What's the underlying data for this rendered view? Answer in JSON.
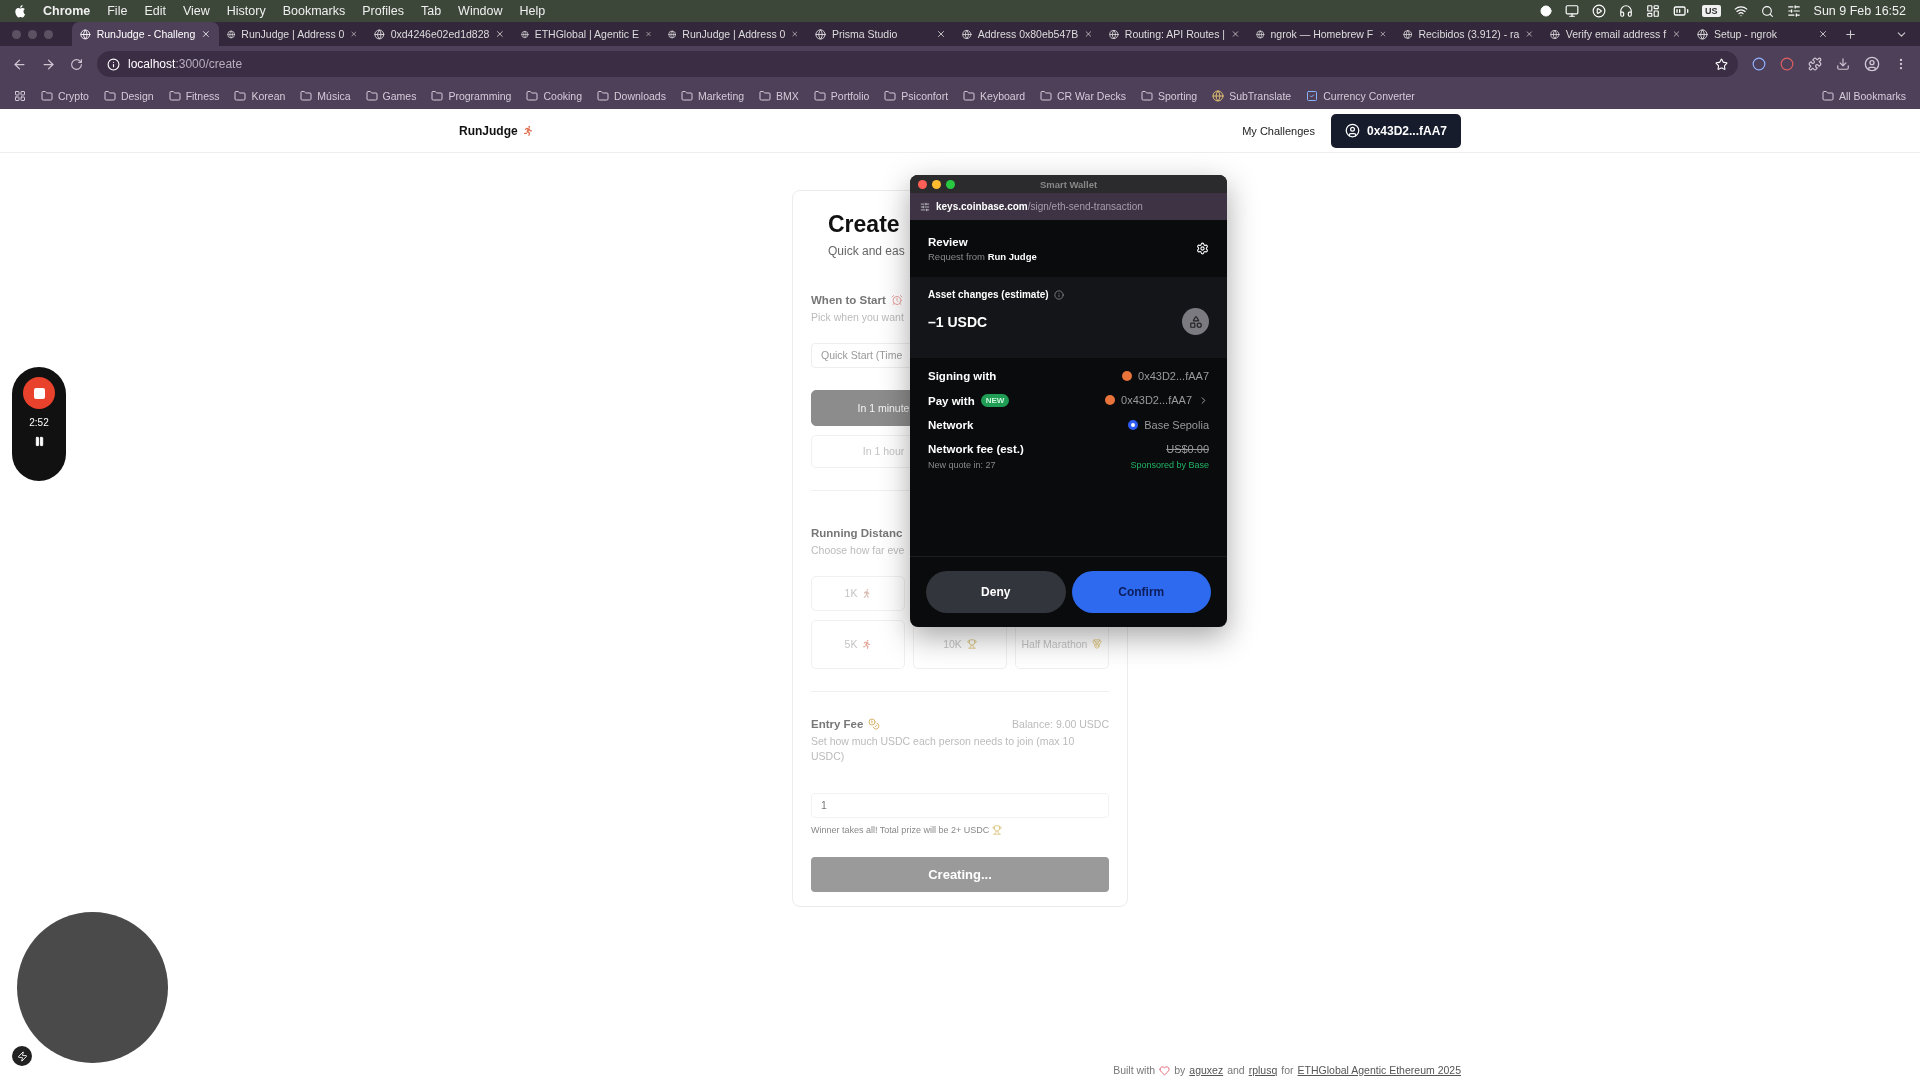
{
  "menu_bar": {
    "app": "Chrome",
    "items": [
      "File",
      "Edit",
      "View",
      "History",
      "Bookmarks",
      "Profiles",
      "Tab",
      "Window",
      "Help"
    ],
    "keyboard": "US",
    "clock": "Sun 9 Feb 16:52"
  },
  "tabs": [
    {
      "title": "RunJudge - Challeng",
      "selected": true
    },
    {
      "title": "RunJudge | Address 0",
      "selected": false
    },
    {
      "title": "0xd4246e02ed1d828",
      "selected": false
    },
    {
      "title": "ETHGlobal | Agentic E",
      "selected": false
    },
    {
      "title": "RunJudge | Address 0",
      "selected": false
    },
    {
      "title": "Prisma Studio",
      "selected": false
    },
    {
      "title": "Address 0x80eb547B",
      "selected": false
    },
    {
      "title": "Routing: API Routes |",
      "selected": false
    },
    {
      "title": "ngrok — Homebrew F",
      "selected": false
    },
    {
      "title": "Recibidos (3.912) - ra",
      "selected": false
    },
    {
      "title": "Verify email address f",
      "selected": false
    },
    {
      "title": "Setup - ngrok",
      "selected": false
    }
  ],
  "address_bar": {
    "host": "localhost",
    "path": ":3000/create"
  },
  "bookmarks": [
    {
      "label": "Crypto",
      "kind": "folder"
    },
    {
      "label": "Design",
      "kind": "folder"
    },
    {
      "label": "Fitness",
      "kind": "folder"
    },
    {
      "label": "Korean",
      "kind": "folder"
    },
    {
      "label": "Música",
      "kind": "folder"
    },
    {
      "label": "Games",
      "kind": "folder"
    },
    {
      "label": "Programming",
      "kind": "folder"
    },
    {
      "label": "Cooking",
      "kind": "folder"
    },
    {
      "label": "Downloads",
      "kind": "folder"
    },
    {
      "label": "Marketing",
      "kind": "folder"
    },
    {
      "label": "BMX",
      "kind": "folder"
    },
    {
      "label": "Portfolio",
      "kind": "folder"
    },
    {
      "label": "Psiconfort",
      "kind": "folder"
    },
    {
      "label": "Keyboard",
      "kind": "folder"
    },
    {
      "label": "CR War Decks",
      "kind": "folder"
    },
    {
      "label": "Sporting",
      "kind": "folder"
    },
    {
      "label": "SubTranslate",
      "kind": "site"
    },
    {
      "label": "Currency Converter",
      "kind": "check"
    }
  ],
  "all_bookmarks": "All Bookmarks",
  "header": {
    "logo": "RunJudge",
    "nav_link": "My Challenges",
    "account": "0x43D2...fAA7"
  },
  "form": {
    "title": "Create",
    "subtitle": "Quick and eas",
    "start": {
      "label": "When to Start",
      "hint": "Pick when you want",
      "field": "Quick Start (Time",
      "options": [
        [
          {
            "label": "In 1 minute",
            "selected": true
          }
        ],
        [
          {
            "label": "In 1 hour",
            "selected": false
          }
        ]
      ]
    },
    "distance": {
      "label": "Running Distanc",
      "hint": "Choose how far eve",
      "options": [
        [
          {
            "label": "1K",
            "kind": "walk",
            "selected": false
          }
        ],
        [
          {
            "label": "5K",
            "kind": "run",
            "selected": false
          },
          {
            "label": "10K",
            "kind": "trophy",
            "selected": false
          },
          {
            "label": "Half Marathon",
            "kind": "medal",
            "selected": false
          }
        ]
      ]
    },
    "fee": {
      "label": "Entry Fee",
      "balance": "Balance: 9.00 USDC",
      "hint": "Set how much USDC each person needs to join (max 10 USDC)",
      "value": "1",
      "note": "Winner takes all! Total prize will be 2+ USDC"
    },
    "submit": {
      "label": "Creating...",
      "disabled": true
    }
  },
  "wallet": {
    "window_title": "Smart Wallet",
    "url_host": "keys.coinbase.com",
    "url_path": "/sign/eth-send-transaction",
    "title": "Review",
    "subtitle": "Request from **Run Judge**",
    "asset_label": "Asset changes (estimate)",
    "asset_amount": "–1 USDC",
    "rows": [
      {
        "kind": "account",
        "label": "Signing with",
        "value": "0x43D2...fAA7",
        "chevron": false
      },
      {
        "kind": "account",
        "label": "Pay with",
        "badge": "NEW",
        "value": "0x43D2...fAA7",
        "chevron": true
      },
      {
        "kind": "network",
        "label": "Network",
        "value": "Base Sepolia",
        "chevron": false
      },
      {
        "kind": "fee",
        "label": "Network fee (est.)",
        "value": "US$0.00",
        "strikethrough": true,
        "note": "New quote in: 27",
        "sponsor": "Sponsored by Base",
        "chevron": false
      }
    ],
    "deny": "Deny",
    "confirm": "Confirm"
  },
  "recorder": {
    "time": "2:52"
  },
  "footer": {
    "lead": "Built with",
    "by": "by",
    "links": [
      "aguxez",
      "rplusq",
      "ETHGlobal Agentic Ethereum 2025"
    ],
    "joins": [
      "and",
      "for"
    ]
  }
}
